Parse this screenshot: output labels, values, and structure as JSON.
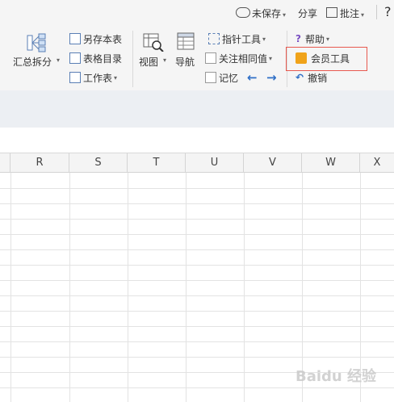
{
  "topbar": {
    "unsaved": "未保存",
    "share": "分享",
    "comment": "批注",
    "help_symbol": "?"
  },
  "ribbon": {
    "summary_split": "汇总拆分",
    "save_as_this_table": "另存本表",
    "table_directory": "表格目录",
    "worksheet": "工作表",
    "view": "视图",
    "navigation": "导航",
    "pointer_tool": "指针工具",
    "focus_same_value": "关注相同值",
    "remember": "记忆",
    "help": "帮助",
    "member_tools": "会员工具",
    "undo": "撤销"
  },
  "grid": {
    "columns": [
      "R",
      "S",
      "T",
      "U",
      "V",
      "W",
      "X"
    ]
  },
  "watermark": "Baidu 经验",
  "colors": {
    "highlight": "#e8594f",
    "arrow_blue": "#2f6fc6",
    "icon_gold": "#f0a31a"
  }
}
